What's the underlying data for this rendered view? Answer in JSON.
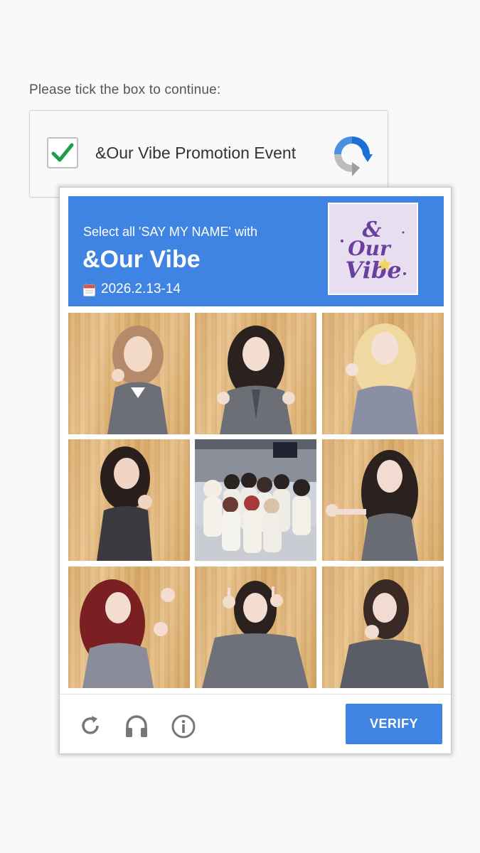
{
  "prompt": "Please tick the box to continue:",
  "checkbox": {
    "label": "&Our Vibe Promotion Event",
    "checked": true
  },
  "challenge": {
    "instruction": "Select all 'SAY MY NAME' with",
    "title": "&Our Vibe",
    "date": "2026.2.13-14",
    "logo_text": "&Our Vibe",
    "tiles": [
      {
        "id": "photo-1",
        "desc": "solo-member-pointing"
      },
      {
        "id": "photo-2",
        "desc": "solo-member-pointing-down"
      },
      {
        "id": "photo-3",
        "desc": "solo-member-blonde"
      },
      {
        "id": "photo-4",
        "desc": "solo-member-dark-vest"
      },
      {
        "id": "photo-5",
        "desc": "group-photo-white-outfits"
      },
      {
        "id": "photo-6",
        "desc": "solo-member-pointing-left"
      },
      {
        "id": "photo-7",
        "desc": "solo-member-red-hair"
      },
      {
        "id": "photo-8",
        "desc": "solo-member-pointing-up"
      },
      {
        "id": "photo-9",
        "desc": "solo-member-hand-chin"
      }
    ],
    "verify_label": "VERIFY"
  },
  "colors": {
    "accent": "#3f84e2",
    "check": "#1e9e4a"
  }
}
